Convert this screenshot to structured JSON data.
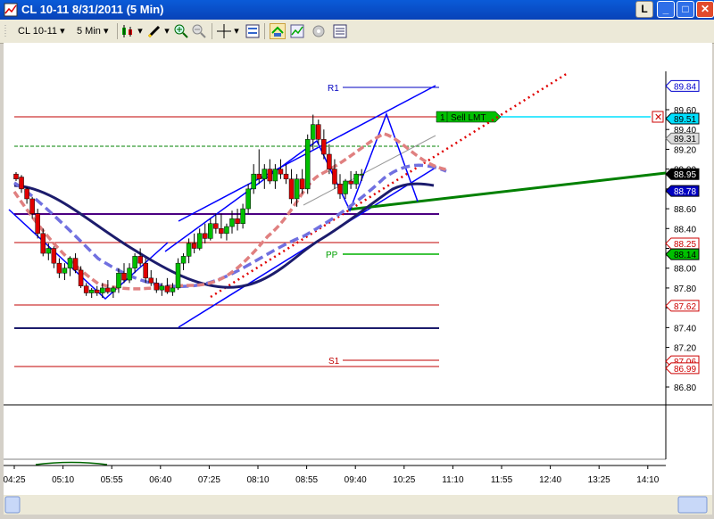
{
  "window": {
    "title": "CL 10-11  8/31/2011 (5 Min)",
    "l_button": "L",
    "min_button": "_",
    "max_button": "□",
    "close_button": "✕"
  },
  "toolbar": {
    "instrument": "CL 10-11",
    "interval": "5 Min",
    "dropdown_glyph": "▾"
  },
  "chart": {
    "levels": {
      "r1": "R1",
      "pp": "PP",
      "s1": "S1"
    },
    "order": {
      "qty": "1",
      "label": "Sell LMT",
      "cancel_glyph": "✕"
    },
    "price_axis": [
      "89.60",
      "89.40",
      "89.20",
      "89.00",
      "88.80",
      "88.60",
      "88.40",
      "88.20",
      "88.00",
      "87.80",
      "87.60",
      "87.40",
      "87.20",
      "87.00",
      "86.80"
    ],
    "price_badges": {
      "r1": "89.84",
      "order": "89.51",
      "green_dashed": "89.31",
      "last": "88.95",
      "lower_band": "88.78",
      "red_upper": "88.25",
      "pp": "88.14",
      "red_mid": "87.62",
      "red_low": "87.06",
      "s1": "86.99"
    },
    "time_axis": [
      "04:25",
      "05:10",
      "05:55",
      "06:40",
      "07:25",
      "08:10",
      "08:55",
      "09:40",
      "10:25",
      "11:10",
      "11:55",
      "12:40",
      "13:25",
      "14:10"
    ]
  },
  "colors": {
    "up_candle": "#00c000",
    "down_candle": "#e00000",
    "trendline": "#0000ff",
    "green_trend": "#008000",
    "ma_navy": "#1c1c6c",
    "ma_blue_dashed": "#7070e0",
    "ma_red_dashed": "#e08080",
    "red_dotted": "#e00000",
    "order_line": "#00e0ff",
    "order_tag": "#00c000"
  }
}
